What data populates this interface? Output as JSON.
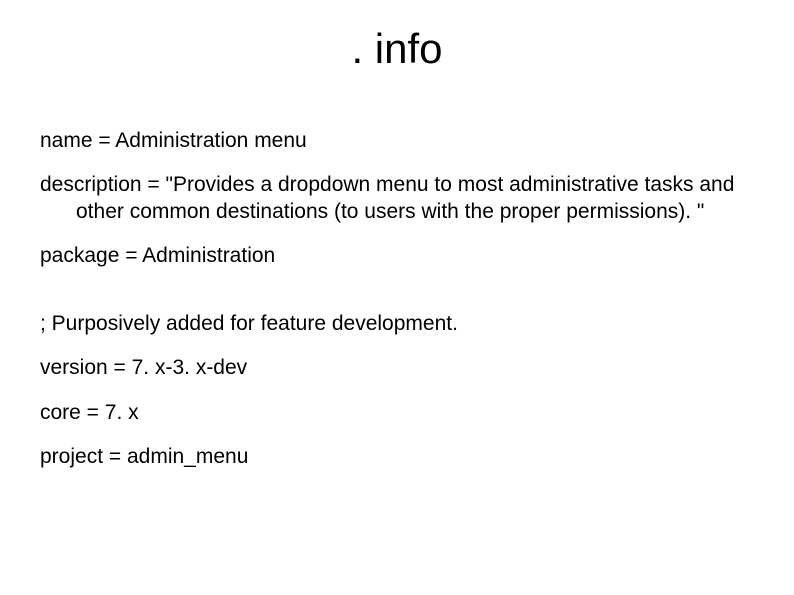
{
  "title": ". info",
  "lines": {
    "name": "name = Administration menu",
    "description": "description = \"Provides a dropdown menu to most administrative tasks and other common destinations (to users with the proper permissions). \"",
    "package": "package = Administration",
    "comment": "; Purposively added for feature development.",
    "version": "version = 7. x-3. x-dev",
    "core": "core = 7. x",
    "project": "project = admin_menu"
  }
}
